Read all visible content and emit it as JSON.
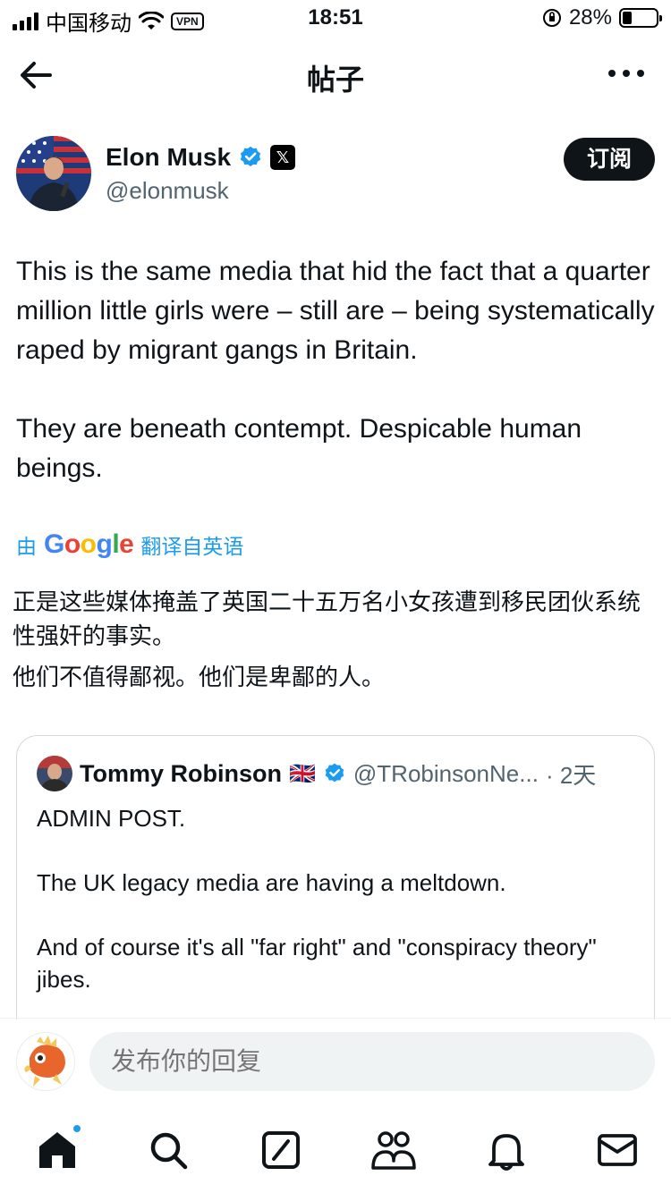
{
  "status_bar": {
    "carrier": "中国移动",
    "vpn": "VPN",
    "time": "18:51",
    "battery": "28%",
    "battery_level": 0.28
  },
  "header": {
    "title": "帖子"
  },
  "author": {
    "name": "Elon Musk",
    "handle": "@elonmusk",
    "badge": "𝕏",
    "subscribe": "订阅"
  },
  "tweet": {
    "text": "This is the same media that hid the fact that a quarter million little girls were – still are – being systematically raped by migrant gangs in Britain.\n\nThey are beneath contempt. Despicable human beings.",
    "translate_prefix": "由",
    "translate_provider": "Google",
    "translate_suffix": "翻译自英语",
    "translated_p1": "正是这些媒体掩盖了英国二十五万名小女孩遭到移民团伙系统性强奸的事实。",
    "translated_p2": "他们不值得鄙视。他们是卑鄙的人。"
  },
  "quote": {
    "name": "Tommy Robinson",
    "flag": "🇬🇧",
    "handle": "@TRobinsonNe...",
    "time": "· 2天",
    "text": "ADMIN POST.\n\nThe UK legacy media are having a meltdown.\n\nAnd of course it's all \"far right\" and \"conspiracy theory\" jibes."
  },
  "reply": {
    "placeholder": "发布你的回复"
  },
  "colors": {
    "accent": "#1d9bf0",
    "text": "#0f1419",
    "secondary": "#536471"
  }
}
